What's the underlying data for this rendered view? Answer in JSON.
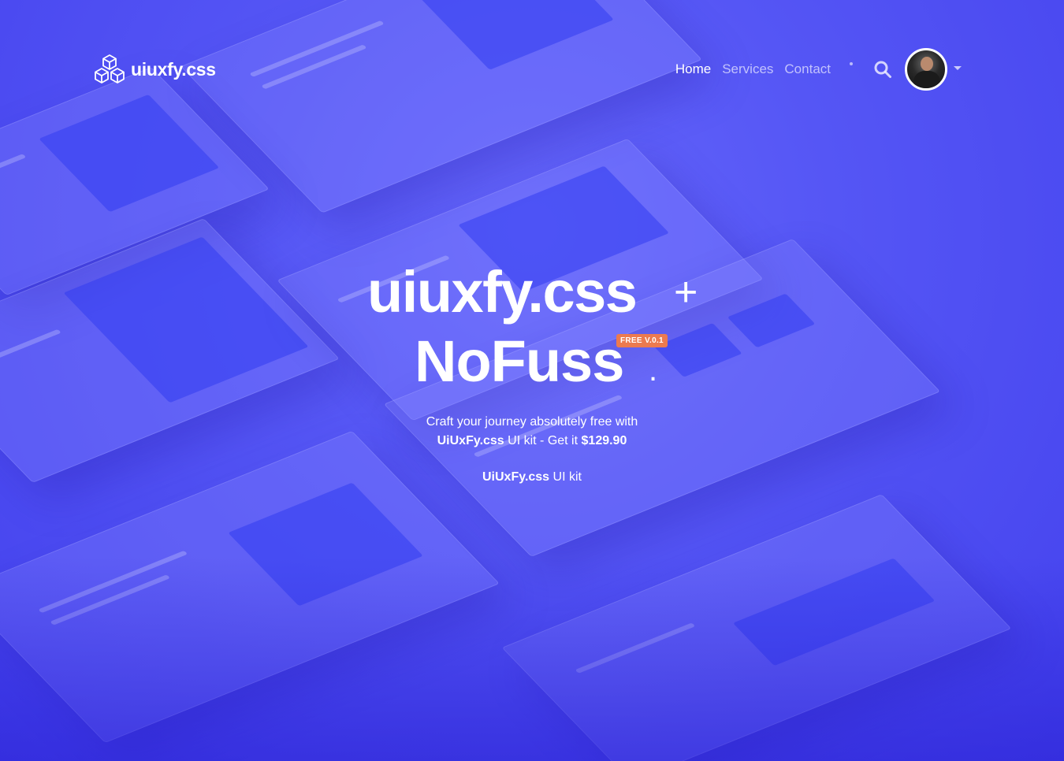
{
  "brand": {
    "name": "uiuxfy.css"
  },
  "nav": {
    "items": [
      {
        "label": "Home",
        "active": true
      },
      {
        "label": "Services",
        "active": false
      },
      {
        "label": "Contact",
        "active": false
      }
    ]
  },
  "hero": {
    "title_line1": "uiuxfy.css",
    "plus": "+",
    "title_line2": "NoFuss",
    "period": ".",
    "badge": "FREE V.0.1",
    "sub_prefix": "Craft your journey absolutely free with",
    "sub_brand": "UiUxFy.css",
    "sub_middle": "UI kit - Get it",
    "sub_price": "$129.90",
    "link_brand": "UiUxFy.css",
    "link_suffix": "UI kit"
  },
  "colors": {
    "background": "#4f4ff5",
    "badge": "#ec7a4f",
    "text": "#ffffff"
  },
  "icons": [
    "cubes-logo-icon",
    "search-icon",
    "chevron-down-icon"
  ]
}
